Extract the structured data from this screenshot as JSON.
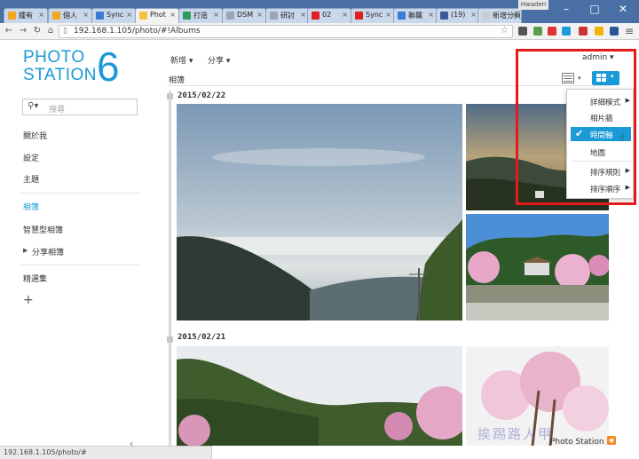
{
  "browser": {
    "tabs": [
      {
        "label": "鍾有",
        "icon_color": "#f5a623"
      },
      {
        "label": "個人",
        "icon_color": "#f5a623"
      },
      {
        "label": "Sync",
        "icon_color": "#3b7bd5"
      },
      {
        "label": "Phot",
        "icon_color": "#f5c242"
      },
      {
        "label": "打造",
        "icon_color": "#2a9d5a"
      },
      {
        "label": "DSM",
        "icon_color": "#9aa4b8"
      },
      {
        "label": "研討",
        "icon_color": "#9aa4b8"
      },
      {
        "label": "02",
        "icon_color": "#e02020"
      },
      {
        "label": "Sync",
        "icon_color": "#e02020"
      },
      {
        "label": "聯羈",
        "icon_color": "#3b7bd5"
      },
      {
        "label": "(19)",
        "icon_color": "#3b5998"
      },
      {
        "label": "新增分頁",
        "icon_color": "#cccccc"
      }
    ],
    "user_chip": "Hwaden",
    "url": "192.168.1.105/photo/#!Albums",
    "status_url": "192.168.1.105/photo/#"
  },
  "sidebar": {
    "logo_line1": "PHOTO",
    "logo_line2": "STATION",
    "logo_number": "6",
    "search_placeholder": "搜尋",
    "items": [
      {
        "label": "關於我"
      },
      {
        "label": "設定"
      },
      {
        "label": "主題"
      },
      {
        "label": "相簿"
      },
      {
        "label": "智慧型相簿"
      },
      {
        "label": "分享相簿"
      },
      {
        "label": "精選集"
      }
    ],
    "add_label": "+",
    "collapse_label": "‹"
  },
  "main": {
    "menu_add": "新增 ▾",
    "menu_share": "分享 ▾",
    "admin_label": "admin ▾",
    "breadcrumb": "相簿",
    "date1": "2015/02/22",
    "date2": "2015/02/21"
  },
  "dropdown": {
    "items": [
      {
        "label": "詳細模式",
        "submenu": true
      },
      {
        "label": "相片牆",
        "submenu": false
      },
      {
        "label": "時間軸",
        "submenu": false,
        "checked": true
      },
      {
        "label": "地圖",
        "submenu": false
      },
      {
        "label": "排序規則",
        "submenu": true
      },
      {
        "label": "排序順序",
        "submenu": true
      }
    ]
  },
  "footer": {
    "label": "Photo Station 6",
    "watermark": "挨踢路人甲"
  },
  "colors": {
    "accent": "#1a9ad6",
    "highlight_box": "#e31b1b"
  }
}
